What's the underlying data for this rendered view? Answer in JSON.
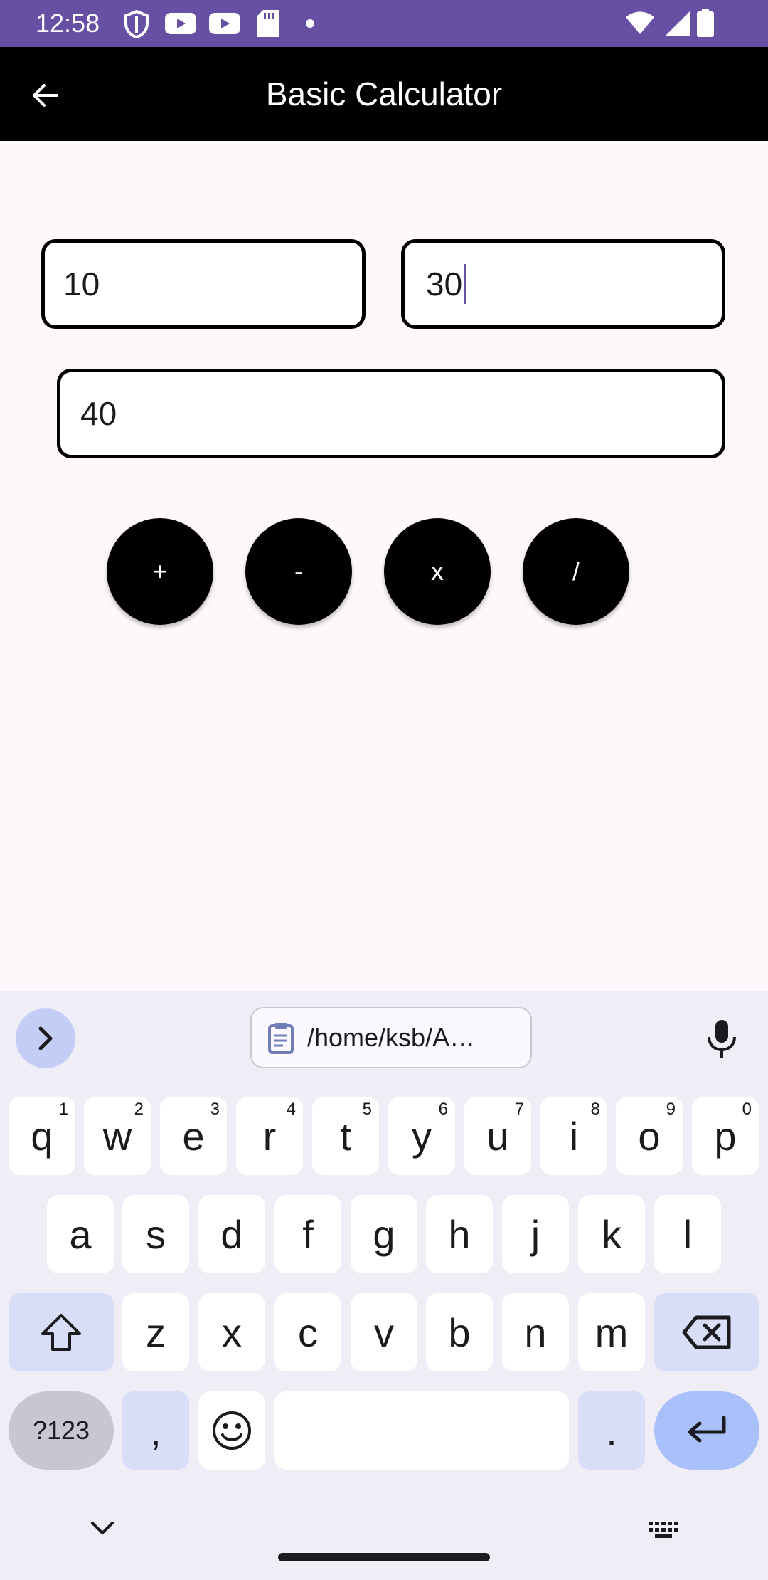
{
  "status_bar": {
    "time": "12:58"
  },
  "app_bar": {
    "title": "Basic Calculator"
  },
  "inputs": {
    "first": "10",
    "second": "30",
    "result": "40"
  },
  "operations": [
    "+",
    "-",
    "x",
    "/"
  ],
  "keyboard": {
    "clipboard_chip": "/home/ksb/A…",
    "row1": [
      {
        "key": "q",
        "hint": "1"
      },
      {
        "key": "w",
        "hint": "2"
      },
      {
        "key": "e",
        "hint": "3"
      },
      {
        "key": "r",
        "hint": "4"
      },
      {
        "key": "t",
        "hint": "5"
      },
      {
        "key": "y",
        "hint": "6"
      },
      {
        "key": "u",
        "hint": "7"
      },
      {
        "key": "i",
        "hint": "8"
      },
      {
        "key": "o",
        "hint": "9"
      },
      {
        "key": "p",
        "hint": "0"
      }
    ],
    "row2": [
      "a",
      "s",
      "d",
      "f",
      "g",
      "h",
      "j",
      "k",
      "l"
    ],
    "row3": [
      "z",
      "x",
      "c",
      "v",
      "b",
      "n",
      "m"
    ],
    "symbols_label": "?123",
    "comma": ",",
    "period": "."
  },
  "colors": {
    "status_bar": "#6750a4",
    "app_bar": "#000000",
    "accent": "#a9c0fb"
  }
}
